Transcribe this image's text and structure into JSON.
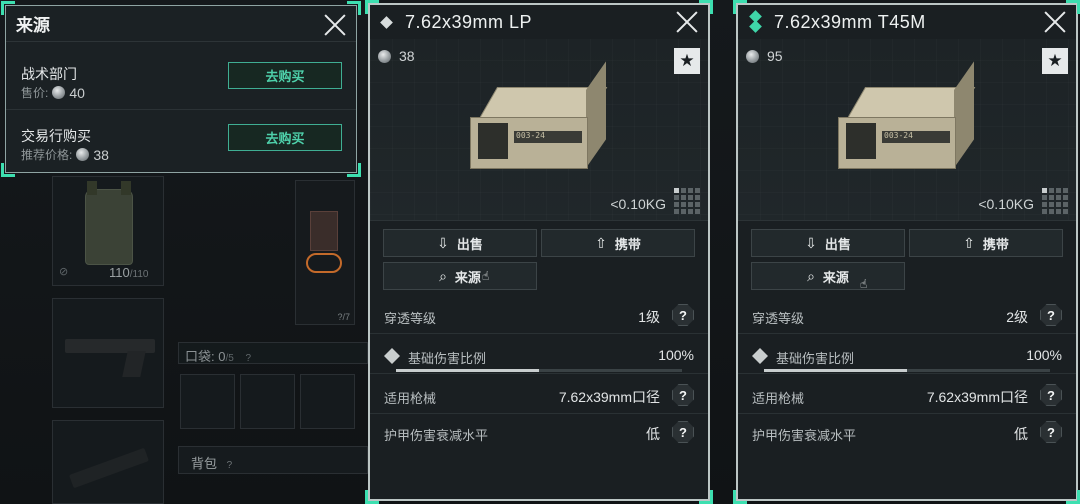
{
  "source_popup": {
    "title": "来源",
    "rows": [
      {
        "name": "战术部门",
        "price_label": "售价:",
        "price": "40",
        "button": "去购买"
      },
      {
        "name": "交易行购买",
        "price_label": "推荐价格:",
        "price": "38",
        "button": "去购买"
      }
    ]
  },
  "background": {
    "durability": "110",
    "durability_max": "/110",
    "pouch_label": "口袋:",
    "pouch_count": "0",
    "pouch_max": "/5",
    "pouch_help": "?",
    "bag_label": "背包",
    "bag_help": "?",
    "slot_label": "?/7"
  },
  "panels": [
    {
      "title": "7.62x39mm LP",
      "price": "38",
      "fav_icon": "★",
      "weight": "<0.10KG",
      "actions": {
        "sell": "出售",
        "carry": "携带",
        "source": "来源"
      },
      "stats": {
        "penetration_label": "穿透等级",
        "penetration_value": "1级",
        "damage_label": "基础伤害比例",
        "damage_value": "100%",
        "damage_fill": 0.5,
        "weapon_label": "适用枪械",
        "weapon_value": "7.62x39mm口径",
        "armor_label": "护甲伤害衰减水平",
        "armor_value": "低",
        "help": "?"
      }
    },
    {
      "title": "7.62x39mm T45M",
      "price": "95",
      "fav_icon": "★",
      "weight": "<0.10KG",
      "actions": {
        "sell": "出售",
        "carry": "携带",
        "source": "来源"
      },
      "stats": {
        "penetration_label": "穿透等级",
        "penetration_value": "2级",
        "damage_label": "基础伤害比例",
        "damage_value": "100%",
        "damage_fill": 0.5,
        "weapon_label": "适用枪械",
        "weapon_value": "7.62x39mm口径",
        "armor_label": "护甲伤害衰减水平",
        "armor_value": "低",
        "help": "?"
      }
    }
  ],
  "box_code": "003-24",
  "colors": {
    "accent": "#3ddfb0",
    "buy_text": "#4ed0aa",
    "panel_bg": "#1a1f22"
  }
}
